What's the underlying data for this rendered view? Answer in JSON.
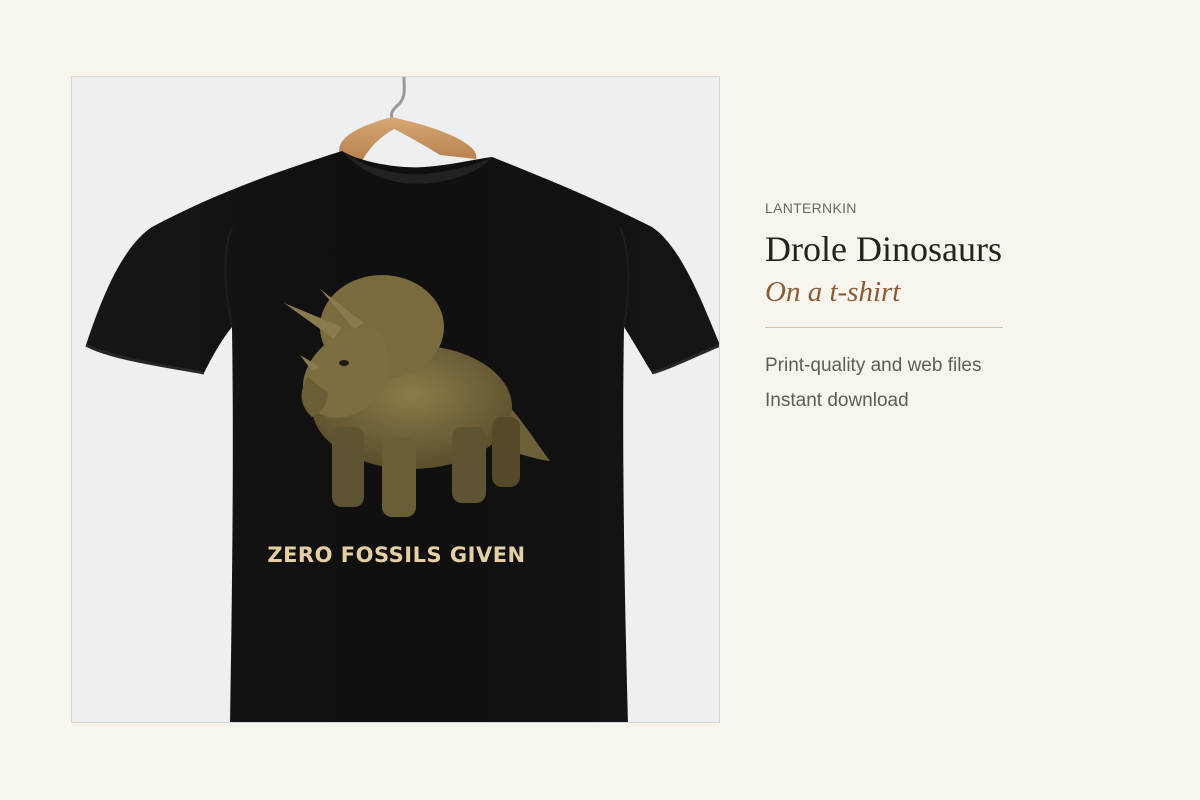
{
  "product_image": {
    "shirt_text": "ZERO FOSSILS GIVEN",
    "shirt_color": "#0e0e0e",
    "graphic": "triceratops-illustration",
    "hanger": "wooden-hanger"
  },
  "info": {
    "brand": "LANTERNKIN",
    "title": "Drole Dinosaurs",
    "subtitle": "On a t-shirt",
    "features": [
      "Print-quality and web files",
      "Instant download"
    ]
  },
  "colors": {
    "background": "#f8f5ee",
    "accent": "#8a5a36",
    "title": "#26231f",
    "slogan": "#e6cfa4"
  }
}
